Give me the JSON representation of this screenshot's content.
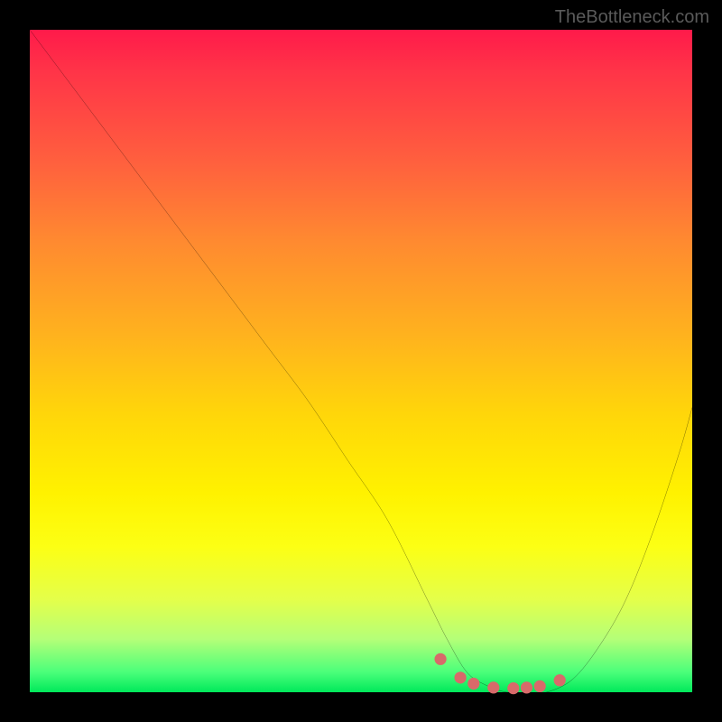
{
  "watermark": "TheBottleneck.com",
  "chart_data": {
    "type": "line",
    "title": "",
    "xlabel": "",
    "ylabel": "",
    "xlim": [
      0,
      100
    ],
    "ylim": [
      0,
      100
    ],
    "series": [
      {
        "name": "curve",
        "x": [
          0,
          6,
          12,
          18,
          24,
          30,
          36,
          42,
          48,
          54,
          60,
          63,
          66,
          69,
          72,
          75,
          78,
          82,
          86,
          90,
          94,
          98,
          100
        ],
        "values": [
          100,
          92,
          84,
          76,
          68,
          60,
          52,
          44,
          35,
          26,
          14,
          8,
          3,
          1,
          0,
          0,
          0,
          2,
          7,
          14,
          24,
          36,
          43
        ]
      }
    ],
    "markers": {
      "name": "bottom-dots",
      "color": "#d86a6a",
      "x": [
        62,
        65,
        67,
        70,
        73,
        75,
        77,
        80
      ],
      "values": [
        5.0,
        2.2,
        1.3,
        0.7,
        0.6,
        0.7,
        0.9,
        1.8
      ]
    }
  }
}
